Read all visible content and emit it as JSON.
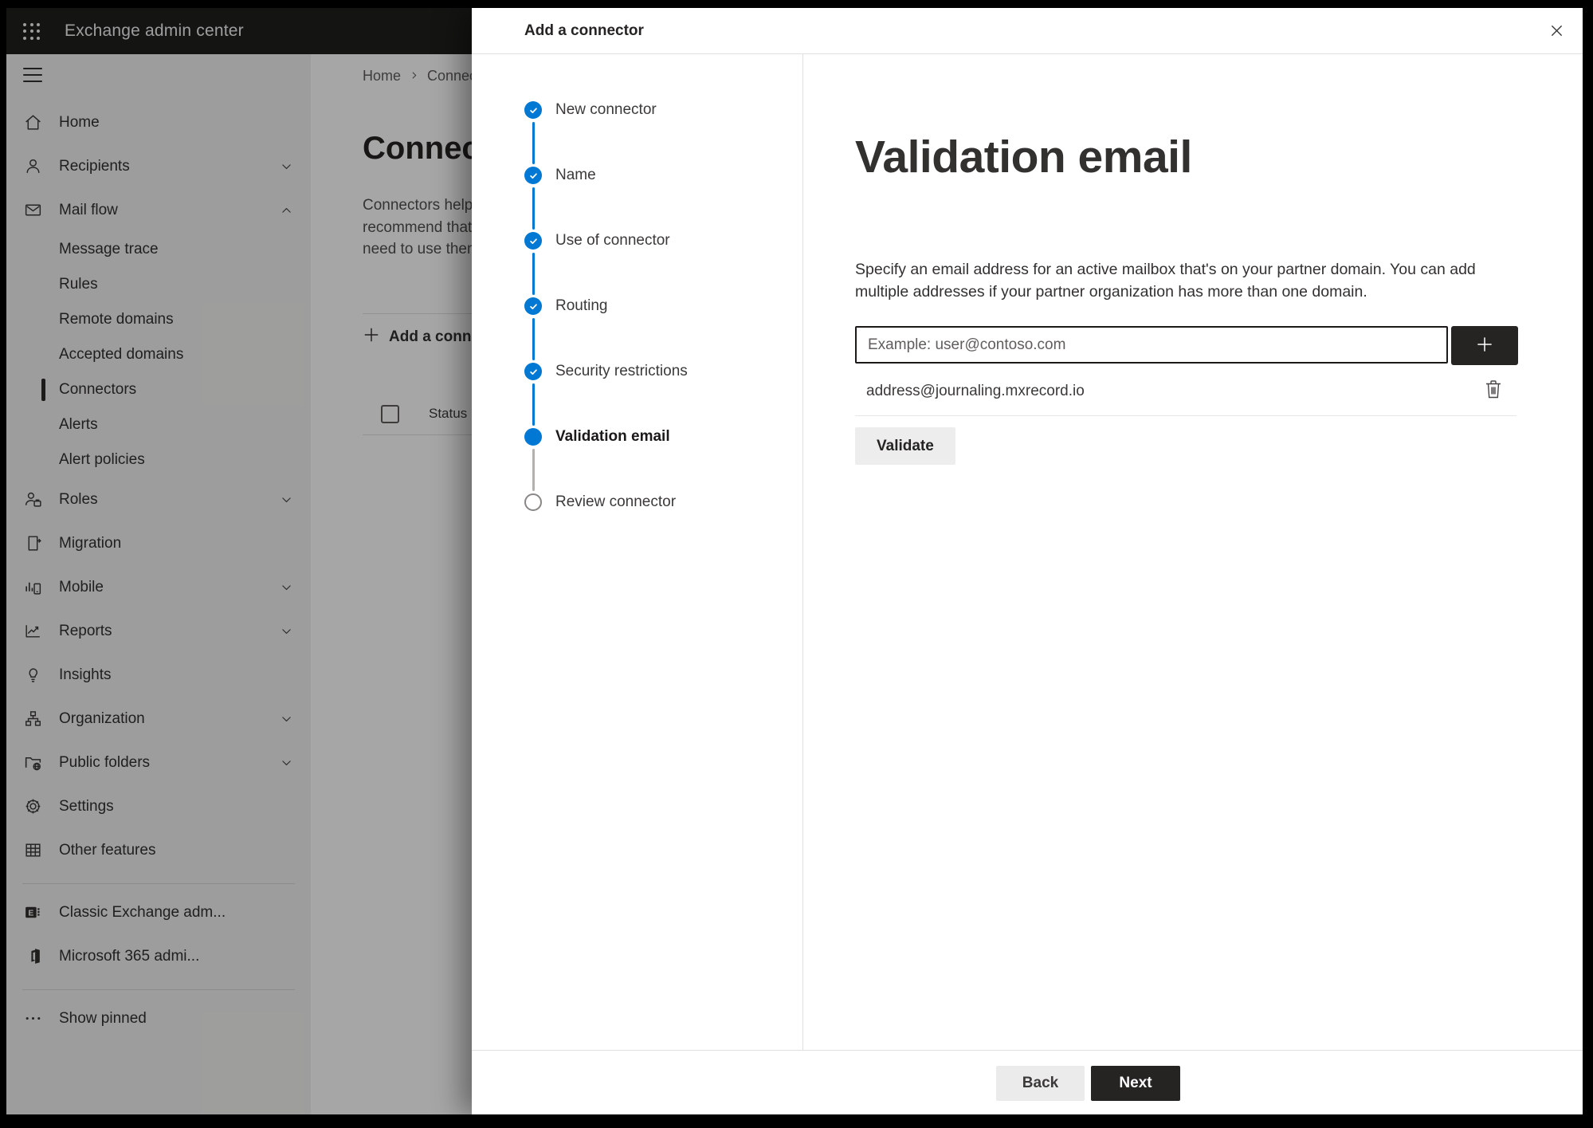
{
  "topbar": {
    "app_title": "Exchange admin center"
  },
  "sidebar": {
    "items": [
      {
        "label": "Home",
        "icon": "home",
        "type": "top"
      },
      {
        "label": "Recipients",
        "icon": "person",
        "type": "top",
        "chevron": "down"
      },
      {
        "label": "Mail flow",
        "icon": "mail",
        "type": "top",
        "chevron": "up"
      },
      {
        "label": "Message trace",
        "type": "sub"
      },
      {
        "label": "Rules",
        "type": "sub"
      },
      {
        "label": "Remote domains",
        "type": "sub"
      },
      {
        "label": "Accepted domains",
        "type": "sub"
      },
      {
        "label": "Connectors",
        "type": "sub",
        "selected": true
      },
      {
        "label": "Alerts",
        "type": "sub"
      },
      {
        "label": "Alert policies",
        "type": "sub"
      },
      {
        "label": "Roles",
        "icon": "person-badge",
        "type": "top",
        "chevron": "down"
      },
      {
        "label": "Migration",
        "icon": "migration",
        "type": "top"
      },
      {
        "label": "Mobile",
        "icon": "mobile",
        "type": "top",
        "chevron": "down"
      },
      {
        "label": "Reports",
        "icon": "chart",
        "type": "top",
        "chevron": "down"
      },
      {
        "label": "Insights",
        "icon": "lightbulb",
        "type": "top"
      },
      {
        "label": "Organization",
        "icon": "org",
        "type": "top",
        "chevron": "down"
      },
      {
        "label": "Public folders",
        "icon": "folder-globe",
        "type": "top",
        "chevron": "down"
      },
      {
        "label": "Settings",
        "icon": "gear",
        "type": "top"
      },
      {
        "label": "Other features",
        "icon": "grid",
        "type": "top"
      },
      {
        "type": "divider"
      },
      {
        "label": "Classic Exchange adm...",
        "icon": "exchange",
        "type": "top"
      },
      {
        "label": "Microsoft 365 admi...",
        "icon": "office",
        "type": "top"
      },
      {
        "type": "divider"
      },
      {
        "label": "Show pinned",
        "icon": "ellipsis",
        "type": "top"
      }
    ]
  },
  "page": {
    "breadcrumb_home": "Home",
    "breadcrumb_current": "Connectors",
    "title": "Connectors",
    "description_lines": [
      "Connectors help",
      "recommend that",
      "need to use them"
    ],
    "add_button_label": "Add a connector",
    "status_column_header": "Status"
  },
  "dialog": {
    "title": "Add a connector",
    "steps": [
      {
        "label": "New connector",
        "state": "done"
      },
      {
        "label": "Name",
        "state": "done"
      },
      {
        "label": "Use of connector",
        "state": "done"
      },
      {
        "label": "Routing",
        "state": "done"
      },
      {
        "label": "Security restrictions",
        "state": "done"
      },
      {
        "label": "Validation email",
        "state": "active"
      },
      {
        "label": "Review connector",
        "state": "upcoming"
      }
    ],
    "content": {
      "heading": "Validation email",
      "description": "Specify an email address for an active mailbox that's on your partner domain. You can add multiple addresses if your partner organization has more than one domain.",
      "email_input_placeholder": "Example: user@contoso.com",
      "added_address": "address@journaling.mxrecord.io",
      "validate_button": "Validate"
    },
    "footer": {
      "back_button": "Back",
      "next_button": "Next"
    }
  },
  "colors": {
    "accent_blue": "#0078d4",
    "topbar_bg": "#201f1e",
    "sidebar_bg": "#f3f2f1",
    "dark_button": "#252423",
    "text_primary": "#323130",
    "text_secondary": "#605e5c"
  }
}
